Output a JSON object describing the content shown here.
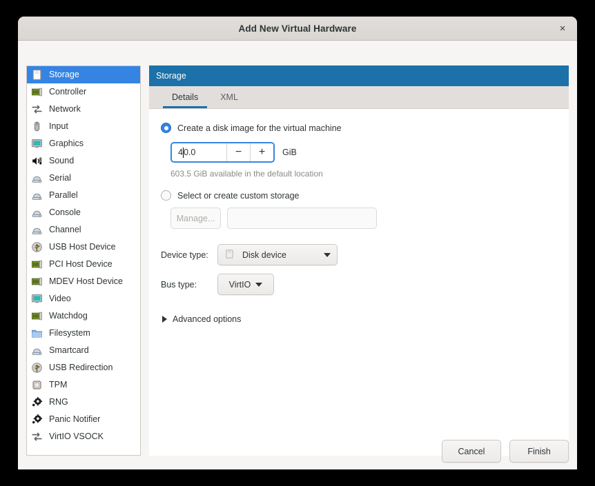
{
  "window": {
    "title": "Add New Virtual Hardware",
    "close_label": "×"
  },
  "sidebar": {
    "items": [
      {
        "label": "Storage",
        "icon": "disk-icon",
        "selected": true
      },
      {
        "label": "Controller",
        "icon": "controller-icon",
        "selected": false
      },
      {
        "label": "Network",
        "icon": "network-icon",
        "selected": false
      },
      {
        "label": "Input",
        "icon": "mouse-icon",
        "selected": false
      },
      {
        "label": "Graphics",
        "icon": "monitor-icon",
        "selected": false
      },
      {
        "label": "Sound",
        "icon": "sound-icon",
        "selected": false
      },
      {
        "label": "Serial",
        "icon": "port-icon",
        "selected": false
      },
      {
        "label": "Parallel",
        "icon": "port-icon",
        "selected": false
      },
      {
        "label": "Console",
        "icon": "port-icon",
        "selected": false
      },
      {
        "label": "Channel",
        "icon": "port-icon",
        "selected": false
      },
      {
        "label": "USB Host Device",
        "icon": "usb-icon",
        "selected": false
      },
      {
        "label": "PCI Host Device",
        "icon": "controller-icon",
        "selected": false
      },
      {
        "label": "MDEV Host Device",
        "icon": "controller-icon",
        "selected": false
      },
      {
        "label": "Video",
        "icon": "monitor-icon",
        "selected": false
      },
      {
        "label": "Watchdog",
        "icon": "controller-icon",
        "selected": false
      },
      {
        "label": "Filesystem",
        "icon": "folder-icon",
        "selected": false
      },
      {
        "label": "Smartcard",
        "icon": "port-icon",
        "selected": false
      },
      {
        "label": "USB Redirection",
        "icon": "usb-icon",
        "selected": false
      },
      {
        "label": "TPM",
        "icon": "chip-icon",
        "selected": false
      },
      {
        "label": "RNG",
        "icon": "gear-icon",
        "selected": false
      },
      {
        "label": "Panic Notifier",
        "icon": "gear-icon",
        "selected": false
      },
      {
        "label": "VirtIO VSOCK",
        "icon": "network-icon",
        "selected": false
      }
    ]
  },
  "content": {
    "header_title": "Storage",
    "tabs": [
      {
        "label": "Details",
        "active": true
      },
      {
        "label": "XML",
        "active": false
      }
    ],
    "create_disk": {
      "radio_label": "Create a disk image for the virtual machine",
      "selected": true,
      "size_value_before_caret": "4",
      "size_value_after_caret": "0.0",
      "size_full_value": "40.0",
      "minus_label": "−",
      "plus_label": "+",
      "unit_label": "GiB",
      "available_text": "603.5 GiB available in the default location"
    },
    "custom_storage": {
      "radio_label": "Select or create custom storage",
      "selected": false,
      "manage_label": "Manage...",
      "path_value": "",
      "path_placeholder": ""
    },
    "device_type": {
      "label": "Device type:",
      "value": "Disk device"
    },
    "bus_type": {
      "label": "Bus type:",
      "value": "VirtIO"
    },
    "advanced_options": {
      "label": "Advanced options",
      "expanded": false
    }
  },
  "footer": {
    "cancel_label": "Cancel",
    "finish_label": "Finish"
  },
  "colors": {
    "accent_blue": "#3584e4",
    "header_blue": "#1c71a8",
    "window_bg": "#f6f5f4",
    "titlebar_bg": "#dad6d2"
  }
}
